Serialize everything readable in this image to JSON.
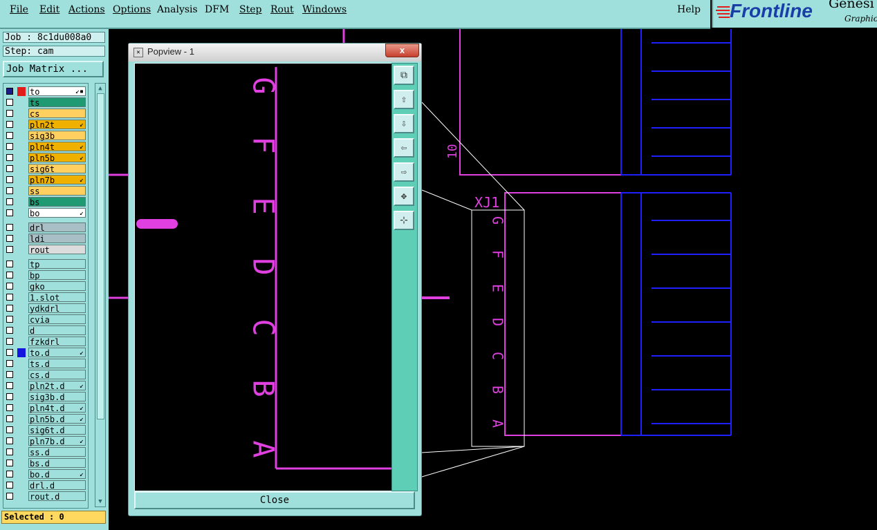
{
  "menu": {
    "items": [
      "File",
      "Edit",
      "Actions",
      "Options",
      "Analysis",
      "DFM",
      "Step",
      "Rout",
      "Windows"
    ],
    "help": "Help"
  },
  "logo": {
    "brand": "Frontline",
    "product": "Genesi",
    "subtitle": "Graphic"
  },
  "left_panel": {
    "job_label": "Job : 8c1du008a0",
    "step_label": "Step: cam",
    "job_matrix_button": "Job Matrix ...",
    "layers": [
      {
        "name": "to",
        "checked": true,
        "color": "#ffffff",
        "swatch": "#e21b1b",
        "icon": "↙▪"
      },
      {
        "name": "ts",
        "checked": false,
        "color": "#1f9a72"
      },
      {
        "name": "cs",
        "checked": false,
        "color": "#ffd060"
      },
      {
        "name": "pln2t",
        "checked": false,
        "color": "#f0b000",
        "icon": "↙"
      },
      {
        "name": "sig3b",
        "checked": false,
        "color": "#ffd060"
      },
      {
        "name": "pln4t",
        "checked": false,
        "color": "#f0b000",
        "icon": "↙"
      },
      {
        "name": "pln5b",
        "checked": false,
        "color": "#f0b000",
        "icon": "↙"
      },
      {
        "name": "sig6t",
        "checked": false,
        "color": "#ffd060"
      },
      {
        "name": "pln7b",
        "checked": false,
        "color": "#f0b000",
        "icon": "↙"
      },
      {
        "name": "ss",
        "checked": false,
        "color": "#ffd060"
      },
      {
        "name": "bs",
        "checked": false,
        "color": "#1f9a72"
      },
      {
        "name": "bo",
        "checked": false,
        "color": "#ffffff",
        "icon": "↙"
      },
      {
        "name": "drl",
        "checked": false,
        "color": "#a9bfc6"
      },
      {
        "name": "ldi",
        "checked": false,
        "color": "#a9bfc6"
      },
      {
        "name": "rout",
        "checked": false,
        "color": "#dcdcdc"
      },
      {
        "name": "tp",
        "checked": false,
        "color": "#9fe0dd"
      },
      {
        "name": "bp",
        "checked": false,
        "color": "#9fe0dd"
      },
      {
        "name": "gko",
        "checked": false,
        "color": "#9fe0dd"
      },
      {
        "name": "1.slot",
        "checked": false,
        "color": "#9fe0dd"
      },
      {
        "name": "ydkdrl",
        "checked": false,
        "color": "#9fe0dd"
      },
      {
        "name": "cvia",
        "checked": false,
        "color": "#9fe0dd"
      },
      {
        "name": "d",
        "checked": false,
        "color": "#9fe0dd"
      },
      {
        "name": "fzkdrl",
        "checked": false,
        "color": "#9fe0dd"
      },
      {
        "name": "to.d",
        "checked": false,
        "color": "#9fe0dd",
        "swatch": "#1515e0",
        "icon": "↙"
      },
      {
        "name": "ts.d",
        "checked": false,
        "color": "#9fe0dd"
      },
      {
        "name": "cs.d",
        "checked": false,
        "color": "#9fe0dd"
      },
      {
        "name": "pln2t.d",
        "checked": false,
        "color": "#9fe0dd",
        "icon": "↙"
      },
      {
        "name": "sig3b.d",
        "checked": false,
        "color": "#9fe0dd"
      },
      {
        "name": "pln4t.d",
        "checked": false,
        "color": "#9fe0dd",
        "icon": "↙"
      },
      {
        "name": "pln5b.d",
        "checked": false,
        "color": "#9fe0dd",
        "icon": "↙"
      },
      {
        "name": "sig6t.d",
        "checked": false,
        "color": "#9fe0dd"
      },
      {
        "name": "pln7b.d",
        "checked": false,
        "color": "#9fe0dd",
        "icon": "↙"
      },
      {
        "name": "ss.d",
        "checked": false,
        "color": "#9fe0dd"
      },
      {
        "name": "bs.d",
        "checked": false,
        "color": "#9fe0dd"
      },
      {
        "name": "bo.d",
        "checked": false,
        "color": "#9fe0dd",
        "icon": "↙"
      },
      {
        "name": "drl.d",
        "checked": false,
        "color": "#9fe0dd"
      },
      {
        "name": "rout.d",
        "checked": false,
        "color": "#9fe0dd"
      }
    ],
    "selected_label": "Selected : 0"
  },
  "canvas": {
    "component_ref": "XJ1",
    "pin_number": "10",
    "pin_letters": [
      "G",
      "F",
      "E",
      "D",
      "C",
      "B",
      "A"
    ],
    "colors": {
      "outline": "#e040e0",
      "traces": "#2020ff",
      "zoom_frame": "#ffffff"
    }
  },
  "popview": {
    "title": "Popview - 1",
    "close_x": "x",
    "close_button": "Close",
    "pin_letters": [
      "G",
      "F",
      "E",
      "D",
      "C",
      "B",
      "A"
    ],
    "toolbar_icons": [
      "fit-window-icon",
      "pan-up-icon",
      "pan-down-icon",
      "pan-left-icon",
      "pan-right-icon",
      "zoom-fit-icon",
      "zoom-home-icon"
    ]
  }
}
